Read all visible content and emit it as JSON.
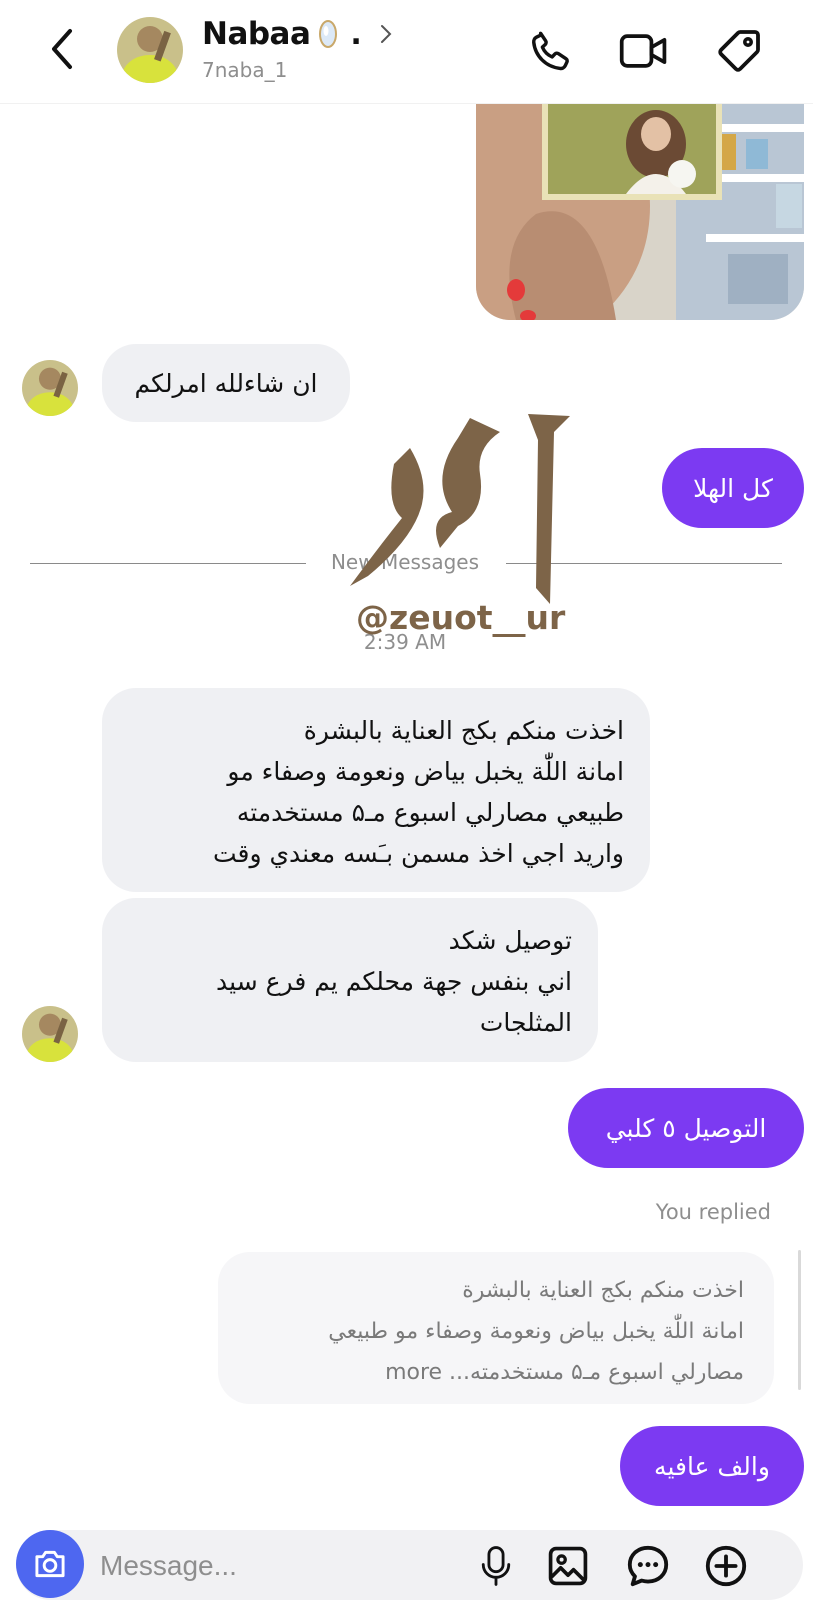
{
  "header": {
    "contact_name": "Nabaa",
    "name_suffix": ".",
    "username": "7naba_1",
    "icons": [
      "back-icon",
      "phone-icon",
      "video-call-icon",
      "tag-icon"
    ]
  },
  "messages": {
    "incoming_1": "ان شاءلله امرلكم",
    "outgoing_1": "كل الهلا",
    "new_messages_label": "New Messages",
    "timestamp": "2:39 AM",
    "incoming_2_lines": [
      "اخذت منكم بكج العناية بالبشرة",
      "امانة اللّٰة يخبل بياض ونعومة وصفاء مو",
      "طبيعي مصارلي اسبوع مـ۵ مستخدمته",
      "واريد اجي اخذ مسمن بـَسه معندي وقت"
    ],
    "incoming_3_lines": [
      "توصيل شكد",
      "اني بنفس جهة محلكم  يم فرع سيد",
      "المثلجات"
    ],
    "outgoing_2": "التوصيل ٥ كلبي",
    "you_replied": "You replied",
    "reply_quote_lines": [
      "اخذت منكم بكج العناية بالبشرة",
      "امانة اللّٰة يخبل بياض ونعومة وصفاء مو طبيعي",
      "مصارلي اسبوع مـ۵ مستخدمته... more"
    ],
    "outgoing_3": "والف عافيه"
  },
  "watermark": {
    "handle": "@zeuot__ur",
    "color": "#7d6448"
  },
  "composer": {
    "placeholder": "Message...",
    "icons": [
      "camera-icon",
      "microphone-icon",
      "gallery-icon",
      "sticker-icon",
      "plus-icon"
    ]
  },
  "colors": {
    "outgoing_bubble": "#7c3af2",
    "incoming_bubble": "#eff0f3",
    "camera_button": "#4e67f0"
  }
}
